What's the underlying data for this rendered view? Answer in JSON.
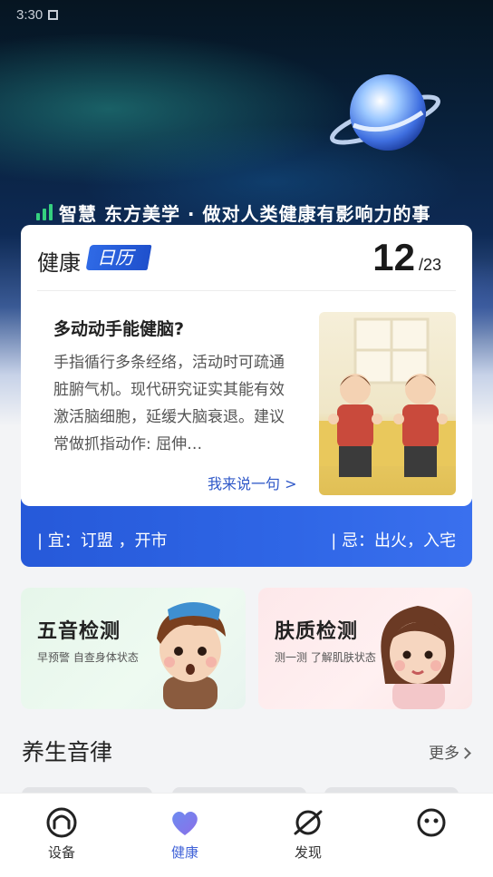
{
  "status_bar": {
    "time": "3:30"
  },
  "hero": {
    "slogan": "智慧 东方美学 · 做对人类健康有影响力的事"
  },
  "calendar": {
    "title": "健康",
    "tag": "日历",
    "day": "12",
    "month": "/23",
    "tip": {
      "title": "多动动手能健脑?",
      "body": "手指循行多条经络，活动时可疏通脏腑气机。现代研究证实其能有效激活脑细胞，延缓大脑衰退。建议常做抓指动作: 屈伸…",
      "link": "我来说一句 >"
    },
    "yi": "| 宜：订盟 ，开市",
    "ji": "| 忌：出火，入宅"
  },
  "features": [
    {
      "title": "五音检测",
      "subtitle": "早预警 自查身体状态"
    },
    {
      "title": "肤质检测",
      "subtitle": "测一测 了解肌肤状态"
    }
  ],
  "section": {
    "title": "养生音律",
    "more": "更多"
  },
  "tabs": [
    {
      "label": "设备",
      "icon": "headphones-icon"
    },
    {
      "label": "健康",
      "icon": "heart-icon",
      "active": true
    },
    {
      "label": "发现",
      "icon": "planet-icon"
    },
    {
      "label": "",
      "icon": "smiley-icon"
    }
  ],
  "colors": {
    "accent": "#2f66e6",
    "active_tab": "#4163d8"
  }
}
